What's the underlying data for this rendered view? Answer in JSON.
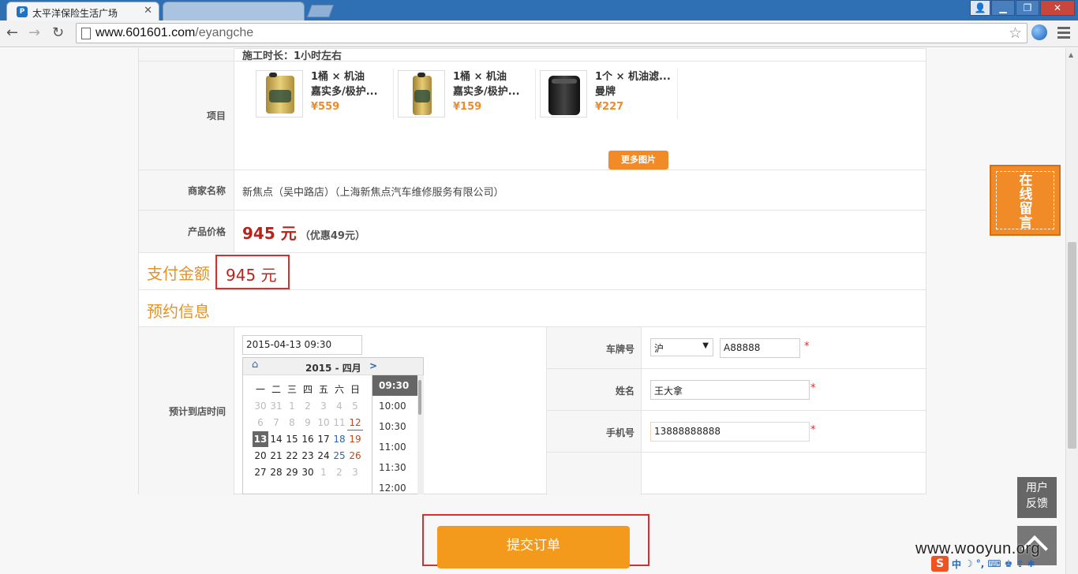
{
  "browser": {
    "tabs": [
      {
        "title": "太平洋保险生活广场",
        "favicon": "P"
      },
      {
        "title": "",
        "favicon": ""
      }
    ],
    "url_domain": "www.601601.com",
    "url_path": "/eyangche",
    "window_buttons": [
      "user",
      "minimize",
      "maximize",
      "close"
    ]
  },
  "form": {
    "cut_text": "施工时长：1小时左右",
    "items_label": "项目",
    "products": [
      {
        "name_line1": "1桶 × 机油",
        "name_line2": "嘉实多/极护...",
        "price": "¥559",
        "icon": "oil-can-gold"
      },
      {
        "name_line1": "1桶 × 机油",
        "name_line2": "嘉实多/极护...",
        "price": "¥159",
        "icon": "oil-bottle-gold"
      },
      {
        "name_line1": "1个 × 机油滤...",
        "name_line2": "曼牌",
        "price": "¥227",
        "icon": "oil-filter-black"
      }
    ],
    "more_images": "更多图片",
    "merchant_label": "商家名称",
    "merchant_value": "新焦点（吴中路店）（上海新焦点汽车维修服务有限公司）",
    "price_label": "产品价格",
    "price_value": "945 元",
    "price_discount": "（优惠49元）",
    "pay_title": "支付金额",
    "pay_value": "945 元",
    "booking_title": "预约信息",
    "arrive_label": "预计到店时间",
    "datetime_value": "2015-04-13 09:30",
    "plate_label": "车牌号",
    "plate_province": "沪",
    "plate_number": "A88888",
    "name_label": "姓名",
    "name_value": "王大拿",
    "phone_label": "手机号",
    "phone_value": "13888888888",
    "required_mark": "*"
  },
  "calendar": {
    "month_title": "2015 - 四月",
    "next": ">",
    "weekdays": [
      "一",
      "二",
      "三",
      "四",
      "五",
      "六",
      "日"
    ],
    "weeks": [
      [
        "30",
        "31",
        "1",
        "2",
        "3",
        "4",
        "5"
      ],
      [
        "6",
        "7",
        "8",
        "9",
        "10",
        "11",
        "12"
      ],
      [
        "13",
        "14",
        "15",
        "16",
        "17",
        "18",
        "19"
      ],
      [
        "20",
        "21",
        "22",
        "23",
        "24",
        "25",
        "26"
      ],
      [
        "27",
        "28",
        "29",
        "30",
        "1",
        "2",
        "3"
      ]
    ],
    "times": [
      "09:30",
      "10:00",
      "10:30",
      "11:00",
      "11:30",
      "12:00"
    ]
  },
  "submit_label": "提交订单",
  "side": {
    "online_message": [
      "在",
      "线",
      "留",
      "言"
    ],
    "feedback": [
      "用户",
      "反馈"
    ]
  },
  "watermark": "www.wooyun.org",
  "ime": {
    "brand": "S",
    "lang": "中"
  },
  "colors": {
    "accent": "#f08b27",
    "price": "#b8231c",
    "highlight_border": "#e02b2b",
    "submit": "#f39a1d"
  }
}
